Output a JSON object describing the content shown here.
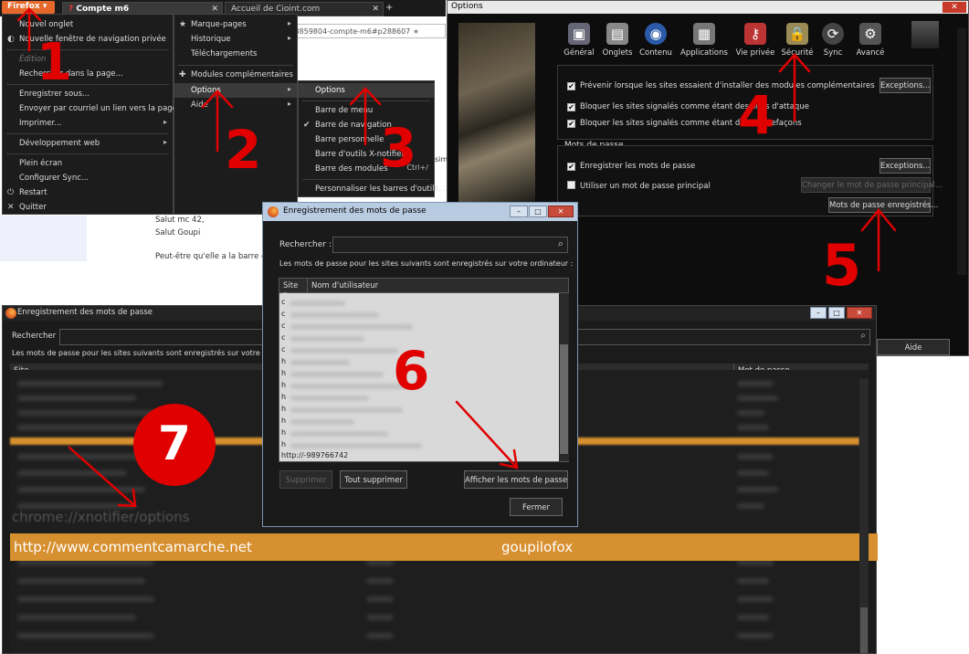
{
  "browser": {
    "firefox_button": "Firefox",
    "tabs": [
      "Compte m6",
      "Accueil de Cioint.com"
    ],
    "url_fragment": "ch-28859804-compte-m6#p288607",
    "page_text": [
      "Salut mc 42,",
      "Salut Goupi",
      "Peut-être qu'elle a la barre de"
    ],
    "side_text": "sim"
  },
  "firefox_menu": {
    "left_items": [
      "Nouvel onglet",
      "Nouvelle fenêtre de navigation privée",
      "Édition",
      "Rechercher dans la page...",
      "Enregistrer sous...",
      "Envoyer par courriel un lien vers la page...",
      "Imprimer...",
      "Développement web",
      "Plein écran",
      "Configurer Sync...",
      "Restart",
      "Quitter"
    ],
    "right_items": [
      "Marque-pages",
      "Historique",
      "Téléchargements",
      "Modules complémentaires",
      "Options",
      "Aide"
    ],
    "options_submenu": [
      "Options",
      "Barre de menu",
      "Barre de navigation",
      "Barre personnelle",
      "Barre d'outils X-notifier",
      "Barre des modules",
      "Personnaliser les barres d'outils..."
    ],
    "shortcut": "Ctrl+/"
  },
  "options_window": {
    "title": "Options",
    "close": "✕",
    "tabs": [
      {
        "label": "Général",
        "icon": "general-icon"
      },
      {
        "label": "Onglets",
        "icon": "tabs-icon"
      },
      {
        "label": "Contenu",
        "icon": "globe-icon"
      },
      {
        "label": "Applications",
        "icon": "applications-icon"
      },
      {
        "label": "Vie privée",
        "icon": "privacy-icon"
      },
      {
        "label": "Sécurité",
        "icon": "lock-icon"
      },
      {
        "label": "Sync",
        "icon": "sync-icon"
      },
      {
        "label": "Avancé",
        "icon": "gear-icon"
      }
    ],
    "security": {
      "warn_addons": "Prévenir lorsque les sites essaient d'installer des modules complémentaires",
      "block_attack": "Bloquer les sites signalés comme étant des sites d'attaque",
      "block_forgery": "Bloquer les sites signalés comme étant des contrefaçons",
      "exceptions": "Exceptions..."
    },
    "passwords": {
      "legend": "Mots de passe",
      "remember": "Enregistrer les mots de passe",
      "use_master": "Utiliser un mot de passe principal",
      "exceptions": "Exceptions...",
      "change_master": "Changer le mot de passe principal...",
      "saved": "Mots de passe enregistrés..."
    },
    "help": "Aide"
  },
  "pw_small": {
    "title": "Enregistrement des mots de passe",
    "search_label": "Rechercher :",
    "description": "Les mots de passe pour les sites suivants sont enregistrés sur votre ordinateur :",
    "col_site": "Site",
    "col_user": "Nom d'utilisateur",
    "site_prefixes": [
      "c",
      "c",
      "c",
      "c",
      "c",
      "h",
      "h",
      "h",
      "h",
      "h",
      "h",
      "h",
      "h"
    ],
    "last_row": "http://-989766742",
    "remove": "Supprimer",
    "remove_all": "Tout supprimer",
    "show_passwords": "Afficher les mots de passe",
    "close": "Fermer"
  },
  "pw_large": {
    "title": "Enregistrement des mots de passe",
    "search_label": "Rechercher :",
    "description": "Les mots de passe pour les sites suivants sont enregistrés sur votre ordinateur :",
    "col_site": "Site",
    "col_password": "Mot de passe",
    "partial_row": "chrome://xnotifier/options",
    "highlight_site": "http://www.commentcamarche.net",
    "highlight_password": "goupilofox"
  },
  "annotations": [
    "1",
    "2",
    "3",
    "4",
    "5",
    "6",
    "7"
  ],
  "colors": {
    "annotation_red": "#e00000",
    "highlight_orange": "#d7902f",
    "firefox_orange": "#e5682a"
  }
}
